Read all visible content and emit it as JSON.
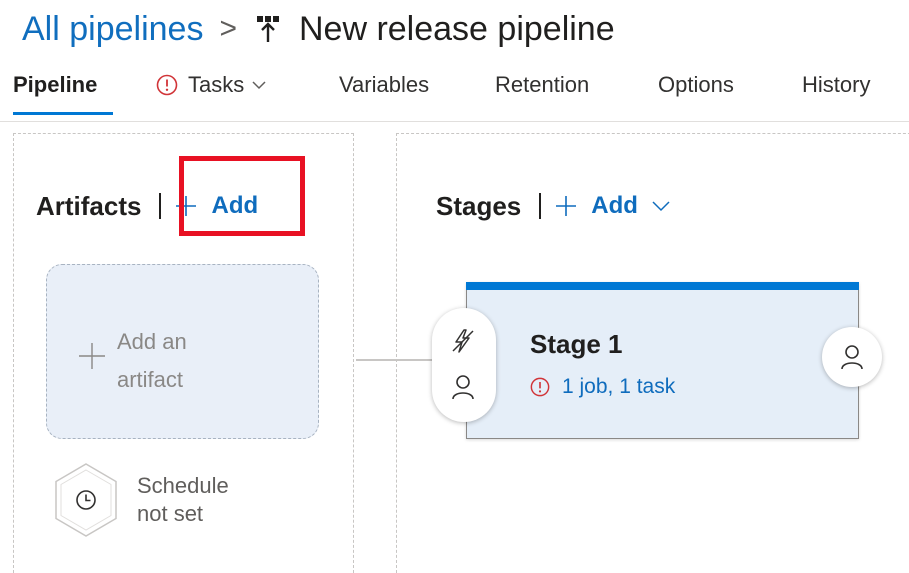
{
  "breadcrumb": {
    "root": "All pipelines",
    "separator": ">",
    "title": "New release pipeline"
  },
  "tabs": [
    {
      "label": "Pipeline",
      "active": true
    },
    {
      "label": "Tasks",
      "has_error": true,
      "has_dropdown": true
    },
    {
      "label": "Variables"
    },
    {
      "label": "Retention"
    },
    {
      "label": "Options"
    },
    {
      "label": "History"
    }
  ],
  "artifacts": {
    "title": "Artifacts",
    "add_label": "Add",
    "card_line1": "Add an",
    "card_line2": "artifact",
    "schedule_line1": "Schedule",
    "schedule_line2": "not set"
  },
  "stages": {
    "title": "Stages",
    "add_label": "Add",
    "items": [
      {
        "name": "Stage 1",
        "status": "1 job, 1 task"
      }
    ]
  },
  "colors": {
    "accent": "#0078d4",
    "link": "#106ebe",
    "error": "#d13438",
    "highlight": "#e81123",
    "stage_bg": "#e5eef8",
    "artifact_bg": "#e9eff8"
  },
  "icons": [
    "pipeline-icon",
    "error-icon",
    "chevron-down-icon",
    "plus-icon",
    "clock-icon",
    "lightning-icon",
    "person-icon"
  ]
}
